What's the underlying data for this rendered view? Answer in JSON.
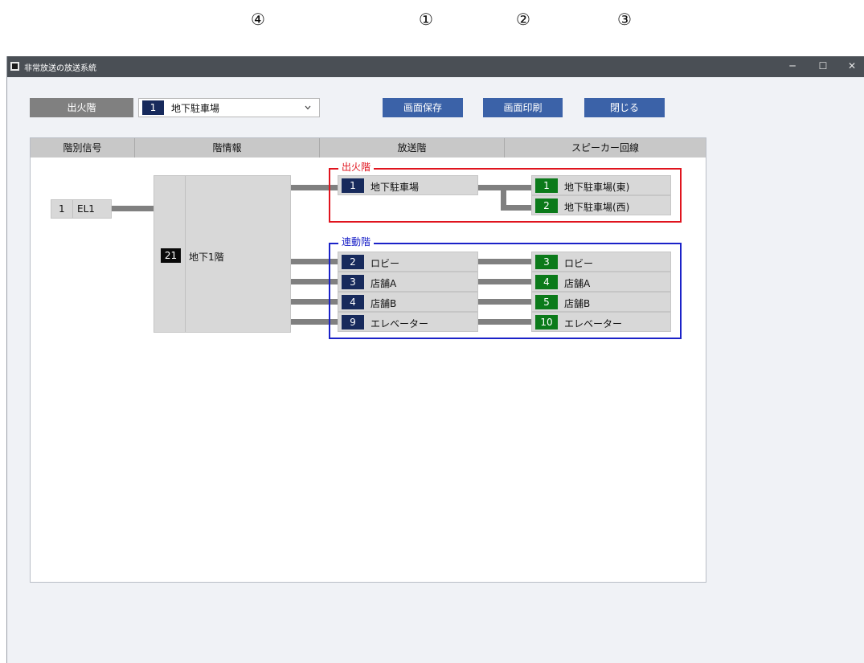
{
  "callouts": [
    "④",
    "①",
    "②",
    "③"
  ],
  "window": {
    "title": "非常放送の放送系統",
    "controls": {
      "minimize": "─",
      "maximize": "☐",
      "close": "✕"
    }
  },
  "toolbar": {
    "fire_floor_label": "出火階",
    "selected_floor": {
      "number": "1",
      "name": "地下駐車場"
    },
    "save_label": "画面保存",
    "print_label": "画面印刷",
    "close_label": "閉じる"
  },
  "columns": [
    "階別信号",
    "階情報",
    "放送階",
    "スピーカー回線"
  ],
  "signal": {
    "number": "1",
    "name": "EL1"
  },
  "floor_info": {
    "number": "21",
    "name": "地下1階"
  },
  "fire_group": {
    "label": "出火階",
    "broadcast": {
      "number": "1",
      "name": "地下駐車場"
    },
    "speakers": [
      {
        "number": "1",
        "name": "地下駐車場(東)"
      },
      {
        "number": "2",
        "name": "地下駐車場(西)"
      }
    ]
  },
  "linked_group": {
    "label": "連動階",
    "rows": [
      {
        "broadcast": {
          "number": "2",
          "name": "ロビー"
        },
        "speaker": {
          "number": "3",
          "name": "ロビー"
        }
      },
      {
        "broadcast": {
          "number": "3",
          "name": "店舗A"
        },
        "speaker": {
          "number": "4",
          "name": "店舗A"
        }
      },
      {
        "broadcast": {
          "number": "4",
          "name": "店舗B"
        },
        "speaker": {
          "number": "5",
          "name": "店舗B"
        }
      },
      {
        "broadcast": {
          "number": "9",
          "name": "エレベーター"
        },
        "speaker": {
          "number": "10",
          "name": "エレベーター"
        }
      }
    ]
  },
  "colors": {
    "accent_button": "#3b62a8",
    "broadcast_badge": "#172a5c",
    "speaker_badge": "#0b7a1a",
    "fire_border": "#e0141e",
    "linked_border": "#1b22c8"
  },
  "icons": {
    "dropdown": "chevron-down-icon",
    "app": "app-window-icon"
  }
}
